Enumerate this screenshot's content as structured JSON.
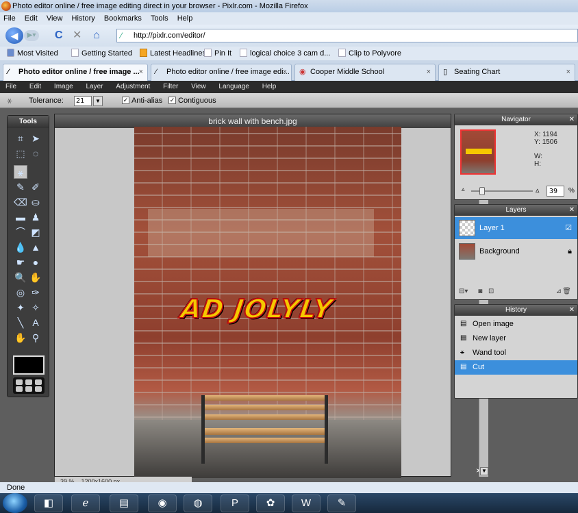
{
  "window": {
    "title": "Photo editor online / free image editing direct in your browser - Pixlr.com - Mozilla Firefox"
  },
  "browser_menu": [
    "File",
    "Edit",
    "View",
    "History",
    "Bookmarks",
    "Tools",
    "Help"
  ],
  "address": {
    "url": "http://pixlr.com/editor/"
  },
  "bookmarks": [
    "Most Visited",
    "Getting Started",
    "Latest Headlines",
    "Pin It",
    "logical choice 3 cam d...",
    "Clip to Polyvore"
  ],
  "tabs": [
    {
      "label": "Photo editor online / free image ...",
      "close": "×"
    },
    {
      "label": "Photo editor online / free image edi...",
      "close": "×"
    },
    {
      "label": "Cooper Middle School",
      "close": "×"
    },
    {
      "label": "Seating Chart",
      "close": "×"
    }
  ],
  "app_menu": [
    "File",
    "Edit",
    "Image",
    "Layer",
    "Adjustment",
    "Filter",
    "View",
    "Language",
    "Help"
  ],
  "tool_options": {
    "tolerance_label": "Tolerance:",
    "tolerance_value": "21",
    "antialias_label": "Anti-alias",
    "antialias_checked": true,
    "contiguous_label": "Contiguous",
    "contiguous_checked": true
  },
  "tools_panel": {
    "title": "Tools",
    "selected_tool": "magic-wand-icon",
    "foreground_color": "#000000"
  },
  "image": {
    "title": "brick wall with bench.jpg",
    "graffiti_text": "AD JOLYLY",
    "zoom_percent": "39",
    "size_text": "1200x1600 px"
  },
  "navigator": {
    "title": "Navigator",
    "x_label": "X:",
    "x": "1194",
    "y_label": "Y:",
    "y": "1506",
    "w_label": "W:",
    "h_label": "H:",
    "zoom": "39",
    "pct": "%"
  },
  "layers": {
    "title": "Layers",
    "items": [
      {
        "name": "Layer 1",
        "selected": true
      },
      {
        "name": "Background",
        "selected": false
      }
    ]
  },
  "history": {
    "title": "History",
    "items": [
      {
        "label": "Open image",
        "selected": false
      },
      {
        "label": "New layer",
        "selected": false
      },
      {
        "label": "Wand tool",
        "selected": false
      },
      {
        "label": "Cut",
        "selected": true
      }
    ]
  },
  "status": {
    "text": "Done"
  },
  "colors": {
    "selection_blue": "#3c8fdc",
    "app_menu_bg": "#2b2b2b"
  }
}
